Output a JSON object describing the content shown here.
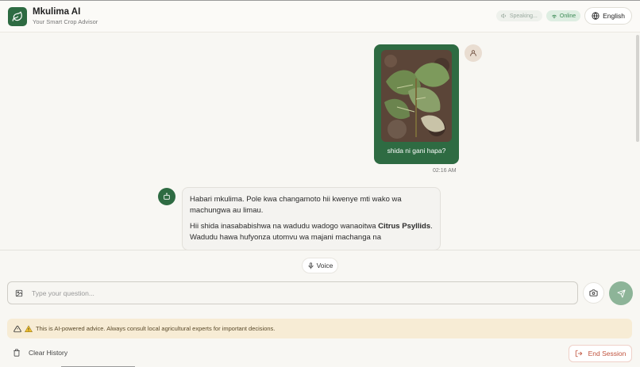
{
  "header": {
    "title": "Mkulima AI",
    "subtitle": "Your Smart Crop Advisor",
    "speaking_label": "Speaking...",
    "online_label": "Online",
    "language_label": "English"
  },
  "chat": {
    "user_message": {
      "text": "shida ni gani hapa?",
      "timestamp": "02:16 AM",
      "image_description": "leaf-photo"
    },
    "bot_message": {
      "paragraph1": "Habari mkulima. Pole kwa changamoto hii kwenye mti wako wa machungwa au limau.",
      "paragraph2_prefix": "Hii shida inasababishwa na wadudu wadogo wanaoitwa ",
      "paragraph2_bold": "Citrus Psyllids",
      "paragraph2_suffix": ". Wadudu hawa hufyonza utomvu wa majani machanga na"
    }
  },
  "composer": {
    "voice_label": "Voice",
    "input_placeholder": "Type your question...",
    "input_value": ""
  },
  "notice": {
    "text": "This is AI-powered advice. Always consult local agricultural experts for important decisions."
  },
  "footer": {
    "clear_label": "Clear History",
    "end_label": "End Session"
  },
  "colors": {
    "brand_green": "#2e6b42",
    "send_green": "#8db498",
    "warning_bg": "#f7ecd5",
    "end_red": "#c0533e"
  }
}
